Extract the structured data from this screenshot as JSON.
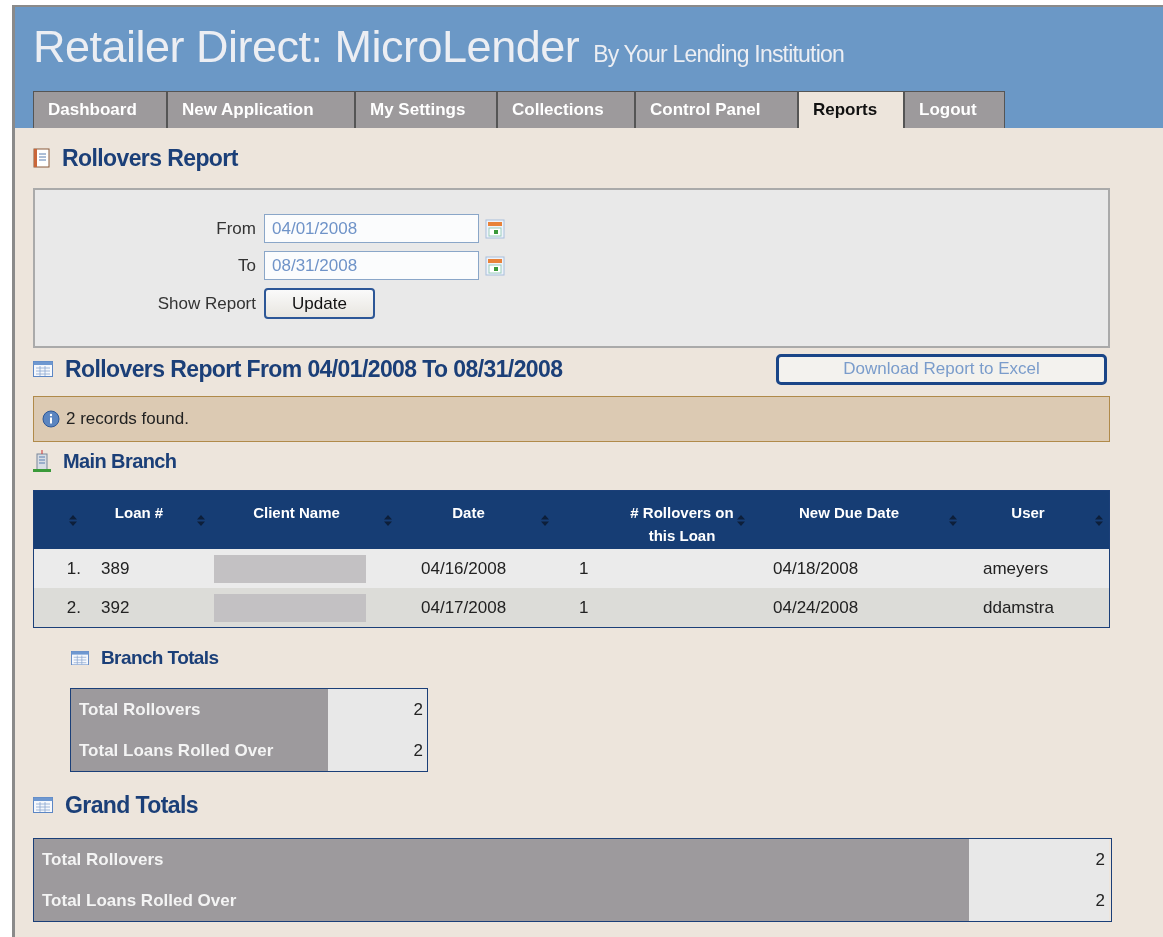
{
  "header": {
    "title": "Retailer Direct: MicroLender",
    "subtitle": "By Your Lending Institution"
  },
  "tabs": [
    {
      "label": "Dashboard",
      "selected": false
    },
    {
      "label": "New Application",
      "selected": false
    },
    {
      "label": "My Settings",
      "selected": false
    },
    {
      "label": "Collections",
      "selected": false
    },
    {
      "label": "Control Panel",
      "selected": false
    },
    {
      "label": "Reports",
      "selected": true
    },
    {
      "label": "Logout",
      "selected": false
    }
  ],
  "page_title": "Rollovers Report",
  "filter": {
    "from_label": "From",
    "from_value": "04/01/2008",
    "to_label": "To",
    "to_value": "08/31/2008",
    "show_label": "Show Report",
    "update_button": "Update"
  },
  "report_title": "Rollovers Report From 04/01/2008 To 08/31/2008",
  "download_button": "Download Report to Excel",
  "info_message": "2 records found.",
  "branch": {
    "name": "Main Branch",
    "columns": [
      "Loan #",
      "Client Name",
      "Date",
      "# Rollovers on this Loan",
      "New Due Date",
      "User"
    ],
    "rows": [
      {
        "number": "1.",
        "loan": "389",
        "client_redacted": true,
        "date": "04/16/2008",
        "rollovers": "1",
        "new_due_date": "04/18/2008",
        "user": "ameyers"
      },
      {
        "number": "2.",
        "loan": "392",
        "client_redacted": true,
        "date": "04/17/2008",
        "rollovers": "1",
        "new_due_date": "04/24/2008",
        "user": "ddamstra"
      }
    ],
    "totals_title": "Branch Totals",
    "totals": [
      {
        "label": "Total Rollovers",
        "value": "2"
      },
      {
        "label": "Total Loans Rolled Over",
        "value": "2"
      }
    ]
  },
  "grand_totals": {
    "title": "Grand Totals",
    "rows": [
      {
        "label": "Total Rollovers",
        "value": "2"
      },
      {
        "label": "Total Loans Rolled Over",
        "value": "2"
      }
    ]
  }
}
